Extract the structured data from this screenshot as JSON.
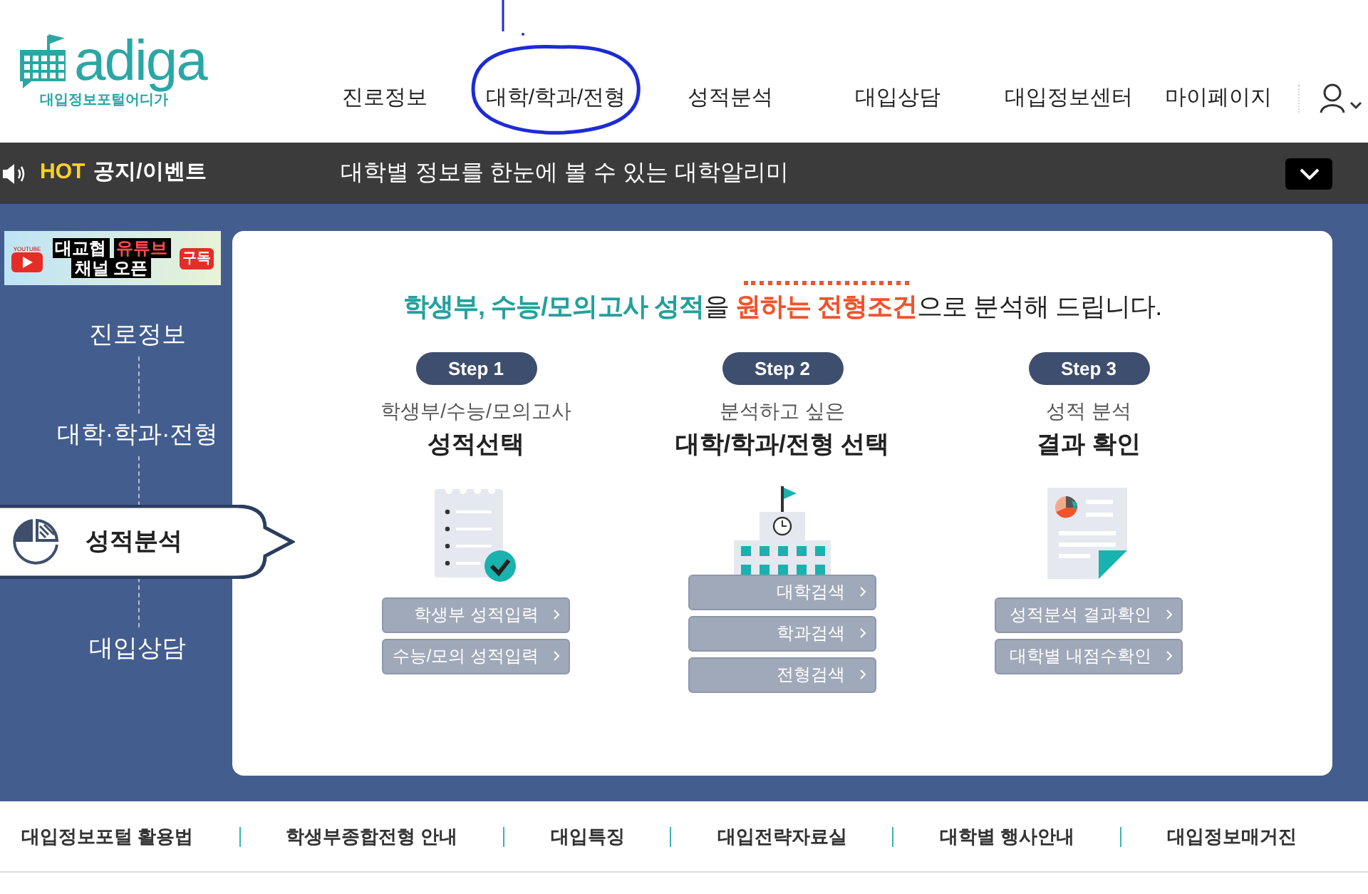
{
  "logo": {
    "wordmark": "adiga",
    "tagline": "대입정보포털어디가"
  },
  "nav": [
    {
      "label": "진로정보"
    },
    {
      "label": "대학/학과/전형",
      "circled": true
    },
    {
      "label": "성적분석"
    },
    {
      "label": "대입상담"
    },
    {
      "label": "대입정보센터"
    },
    {
      "label": "마이페이지"
    }
  ],
  "ticker": {
    "badge": "HOT",
    "label": "공지/이벤트",
    "message": "대학별 정보를 한눈에 볼 수 있는 대학알리미"
  },
  "banner": {
    "badge": "YOUTUBE",
    "line1_plain": "대교협",
    "line1_red": "유튜브",
    "line2": "채널 오픈",
    "subscribe": "구독"
  },
  "sidebar": [
    {
      "label": "진로정보",
      "selected": false
    },
    {
      "label": "대학·학과·전형",
      "selected": false
    },
    {
      "label": "성적분석",
      "selected": true
    },
    {
      "label": "대입상담",
      "selected": false
    }
  ],
  "headline": [
    {
      "kind": "teal",
      "text": "학생부, 수능/모의고사 성적"
    },
    {
      "kind": "plain",
      "text": "을 "
    },
    {
      "kind": "orange",
      "text": "원하는 전형조건"
    },
    {
      "kind": "plain",
      "text": "으로 분석해 드립니다."
    }
  ],
  "steps": [
    {
      "step": "Step 1",
      "subtitle": "학생부/수능/모의고사",
      "title": "성적선택",
      "buttons": [
        "학생부 성적입력",
        "수능/모의 성적입력"
      ]
    },
    {
      "step": "Step 2",
      "subtitle": "분석하고 싶은",
      "title": "대학/학과/전형 선택",
      "buttons": [
        "대학검색",
        "학과검색",
        "전형검색"
      ]
    },
    {
      "step": "Step 3",
      "subtitle": "성적 분석",
      "title": "결과 확인",
      "buttons": [
        "성적분석 결과확인",
        "대학별 내점수확인"
      ]
    }
  ],
  "footer_links": [
    "대입정보포털 활용법",
    "학생부종합전형 안내",
    "대입특징",
    "대입전략자료실",
    "대학별 행사안내",
    "대입정보매거진"
  ]
}
